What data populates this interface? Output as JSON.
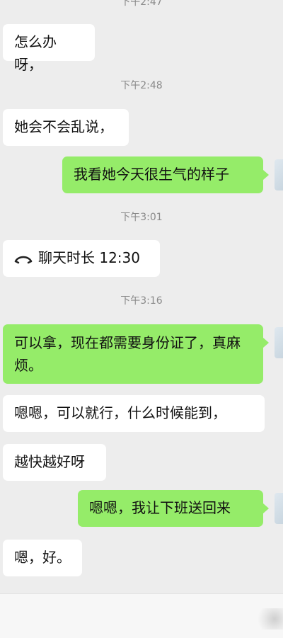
{
  "timestamps": [
    "下午2:47",
    "下午2:48",
    "下午3:01",
    "下午3:16"
  ],
  "messages": {
    "m1": "怎么办呀，",
    "m2": "她会不会乱说，",
    "m3": "我看她今天很生气的样子",
    "m4": "聊天时长 12:30",
    "m5": "可以拿，现在都需要身份证了，真麻烦。",
    "m6": "嗯嗯，可以就行，什么时候能到，",
    "m7": "越快越好呀",
    "m8": "嗯嗯，我让下班送回来",
    "m9": "嗯，好。"
  },
  "icons": {
    "call": "phone-handset-icon"
  },
  "colors": {
    "background": "#ededed",
    "incoming": "#ffffff",
    "outgoing": "#95ec69",
    "timestamp": "#8a8a8a"
  }
}
